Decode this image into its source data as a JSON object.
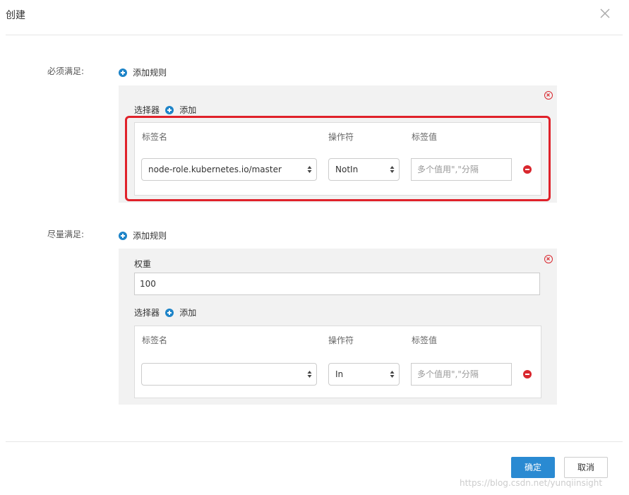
{
  "dialog": {
    "title": "创建"
  },
  "required": {
    "label": "必须满足:",
    "add_rule": "添加规则",
    "selector_label": "选择器",
    "selector_add": "添加",
    "headers": {
      "name": "标签名",
      "op": "操作符",
      "value": "标签值"
    },
    "row": {
      "name": "node-role.kubernetes.io/master",
      "op": "NotIn",
      "value_placeholder": "多个值用\",\"分隔"
    }
  },
  "preferred": {
    "label": "尽量满足:",
    "add_rule": "添加规则",
    "weight_label": "权重",
    "weight_value": "100",
    "selector_label": "选择器",
    "selector_add": "添加",
    "headers": {
      "name": "标签名",
      "op": "操作符",
      "value": "标签值"
    },
    "row": {
      "name": "",
      "op": "In",
      "value_placeholder": "多个值用\",\"分隔"
    }
  },
  "footer": {
    "confirm": "确定",
    "cancel": "取消"
  },
  "watermark": "https://blog.csdn.net/yunqiinsight",
  "colors": {
    "accent": "#2a8ad2",
    "danger": "#d9272e",
    "highlight": "#e0212a"
  }
}
